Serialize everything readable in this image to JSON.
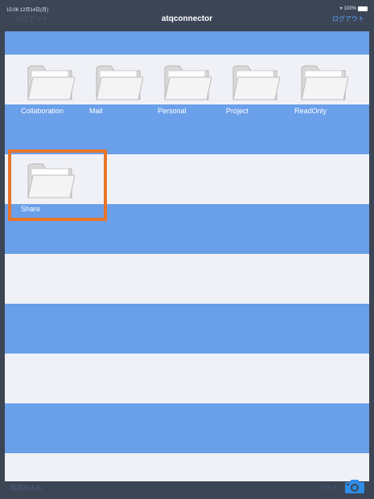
{
  "status_bar": {
    "time": "15:06  12月14日(月)",
    "battery": "100%"
  },
  "nav": {
    "back_label": "ログアウト",
    "title": "atqconnector",
    "right_label": "ログアウト"
  },
  "folders_row1": [
    {
      "label": "Collaboration"
    },
    {
      "label": "Mail"
    },
    {
      "label": "Personal"
    },
    {
      "label": "Project"
    },
    {
      "label": "ReadOnly"
    }
  ],
  "folders_row2": [
    {
      "label": "Share"
    }
  ],
  "toolbar": {
    "reload_label": "再読み込み",
    "sort_label": "ソート"
  },
  "colors": {
    "row_blue": "#6a9fe9",
    "row_light": "#f0f1f6",
    "bar": "#3b4556",
    "highlight": "#e6762c"
  }
}
